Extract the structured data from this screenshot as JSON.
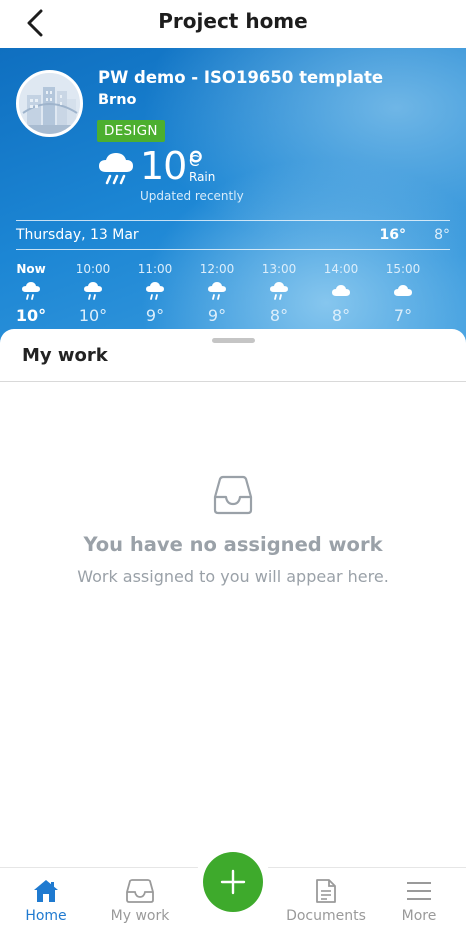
{
  "header": {
    "title": "Project home",
    "back_icon": "chevron-left-icon"
  },
  "project": {
    "name": "PW demo - ISO19650 template",
    "city": "Brno",
    "status_badge": "DESIGN",
    "badge_color": "#4caf2f"
  },
  "weather": {
    "current_temp": "10°",
    "unit": "C",
    "condition": "Rain",
    "updated": "Updated recently",
    "icon": "rain-cloud-icon",
    "day": {
      "label": "Thursday, 13 Mar",
      "high": "16°",
      "low": "8°"
    },
    "hourly": [
      {
        "time": "Now",
        "temp": "10°",
        "icon": "rain-icon"
      },
      {
        "time": "10:00",
        "temp": "10°",
        "icon": "rain-icon"
      },
      {
        "time": "11:00",
        "temp": "9°",
        "icon": "rain-icon"
      },
      {
        "time": "12:00",
        "temp": "9°",
        "icon": "rain-icon"
      },
      {
        "time": "13:00",
        "temp": "8°",
        "icon": "rain-icon"
      },
      {
        "time": "14:00",
        "temp": "8°",
        "icon": "cloud-icon"
      },
      {
        "time": "15:00",
        "temp": "7°",
        "icon": "cloud-icon"
      }
    ]
  },
  "my_work": {
    "title": "My work",
    "empty_title": "You have no assigned work",
    "empty_subtitle": "Work assigned to you will appear here.",
    "empty_icon": "inbox-tray-icon"
  },
  "bottom_nav": {
    "items": [
      {
        "label": "Home",
        "icon": "home-icon",
        "active": true
      },
      {
        "label": "My work",
        "icon": "inbox-icon",
        "active": false
      },
      {
        "label": "Documents",
        "icon": "document-icon",
        "active": false
      },
      {
        "label": "More",
        "icon": "menu-icon",
        "active": false
      }
    ],
    "fab_icon": "plus-icon"
  },
  "colors": {
    "accent": "#1f7ad0",
    "fab": "#3eaa2c",
    "hero_blue": "#1c86d4"
  }
}
